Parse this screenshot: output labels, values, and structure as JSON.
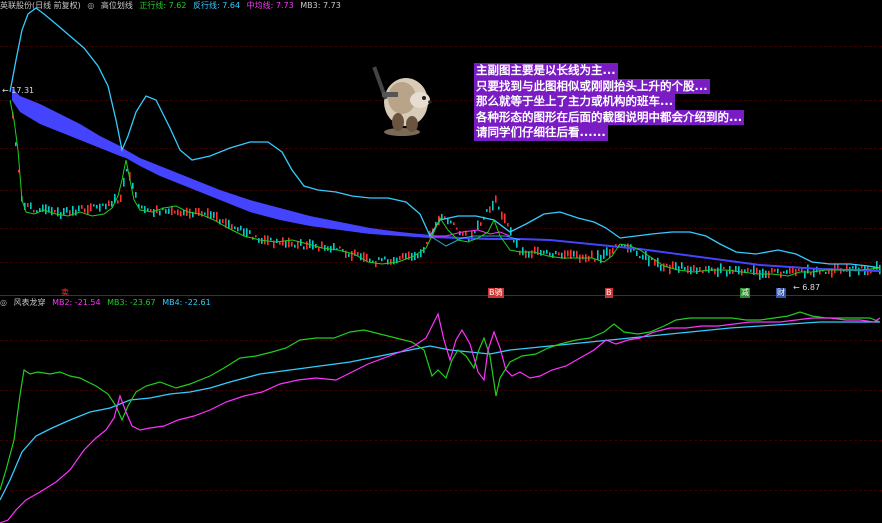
{
  "main_legend": {
    "title": "英联股份(日线 前复权)",
    "indicator": "高位划线",
    "lines": [
      {
        "label": "正行线: 7.62",
        "color": "#22cc22"
      },
      {
        "label": "反行线: 7.64",
        "color": "#33ccff"
      },
      {
        "label": "中均线: 7.73",
        "color": "#ff33ff"
      },
      {
        "label": "MB3: 7.73",
        "color": "#c8c8c8"
      }
    ]
  },
  "sub_legend": {
    "indicator": "风表龙穿",
    "lines": [
      {
        "label": "MB2: -21.54",
        "color": "#ff33ff"
      },
      {
        "label": "MB3: -23.67",
        "color": "#22cc22"
      },
      {
        "label": "MB4: -22.61",
        "color": "#33ccff"
      }
    ]
  },
  "price_labels": {
    "high": "← 17.31",
    "low": "← 6.87"
  },
  "note_lines": [
    "主副图主要是以长线为主...",
    "只要找到与此图相似或刚刚抬头上升的个股...",
    "那么就等于坐上了主力或机构的班车...",
    "各种形态的图形在后面的截图说明中都会介绍到的...",
    "请同学们仔细往后看......"
  ],
  "tags": [
    {
      "text": "卖",
      "color": "#ff3333",
      "bg": "#000000"
    },
    {
      "text": "B骑",
      "color": "#ffffff",
      "bg": "#cc3333"
    },
    {
      "text": "B",
      "color": "#ffffff",
      "bg": "#cc3333"
    },
    {
      "text": "减",
      "color": "#ffffff",
      "bg": "#2a8a2a"
    },
    {
      "text": "财",
      "color": "#ffffff",
      "bg": "#3355aa"
    }
  ],
  "colors": {
    "up": "#ff3030",
    "down": "#00cccc",
    "green": "#22cc22",
    "cyan": "#33ccff",
    "magenta": "#ff33ff",
    "ribbon": "#4444ff"
  }
}
